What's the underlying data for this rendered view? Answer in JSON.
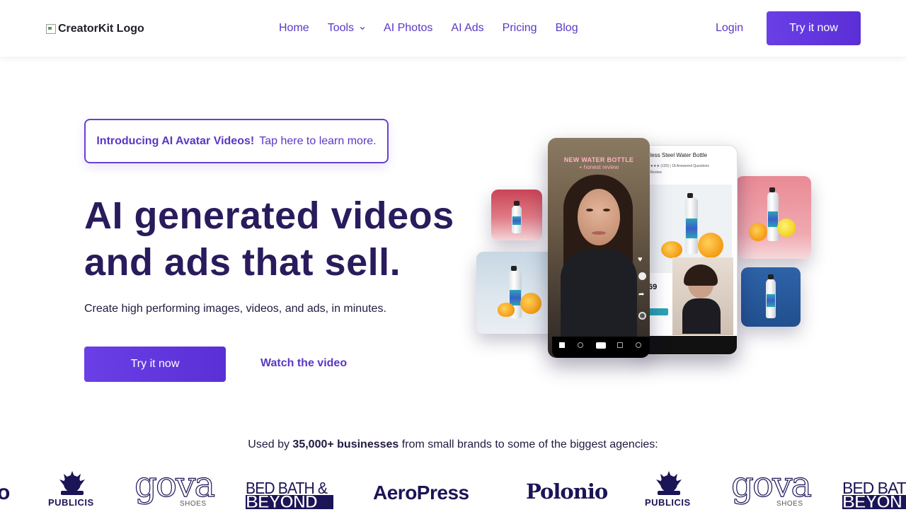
{
  "nav": {
    "logo_alt": "CreatorKit Logo",
    "items": [
      {
        "label": "Home"
      },
      {
        "label": "Tools"
      },
      {
        "label": "AI Photos"
      },
      {
        "label": "AI Ads"
      },
      {
        "label": "Pricing"
      },
      {
        "label": "Blog"
      }
    ],
    "login": "Login",
    "cta": "Try it now"
  },
  "hero": {
    "announce_bold": "Introducing AI Avatar Videos!",
    "announce_rest": "Tap here to learn more.",
    "headline_line1": "AI generated videos",
    "headline_line2": "and ads that sell.",
    "subtitle": "Create high performing images, videos, and ads, in minutes.",
    "cta": "Try it now",
    "watch": "Watch the video"
  },
  "collage": {
    "video_overlay_line1": "NEW WATER BOTTLE",
    "video_overlay_line2": "+ honest review",
    "product_title": "nless Steel Water Bottle",
    "product_rating": "★★★★ (120) | 18 Answered Questions",
    "product_sub": "A Review",
    "price_fragment": "69"
  },
  "social_proof": {
    "prefix": "Used by",
    "count": "35,000+ businesses",
    "suffix": "from small brands to some of the biggest agencies:"
  },
  "brands": {
    "partial_left": "o",
    "publicis": "PUBLICIS",
    "gova": "gova",
    "gova_sub": "SHOES",
    "bbb_top": "BED BATH &",
    "bbb_bottom": "BEYOND",
    "aeropress": "AeroPress",
    "polonio": "Polonio",
    "bbb_top_partial": "BED BATH",
    "bbb_bottom_partial": "BEYON"
  },
  "colors": {
    "accent": "#5b37c4",
    "heading": "#2a1b5c",
    "button": "#6a3fe6"
  }
}
